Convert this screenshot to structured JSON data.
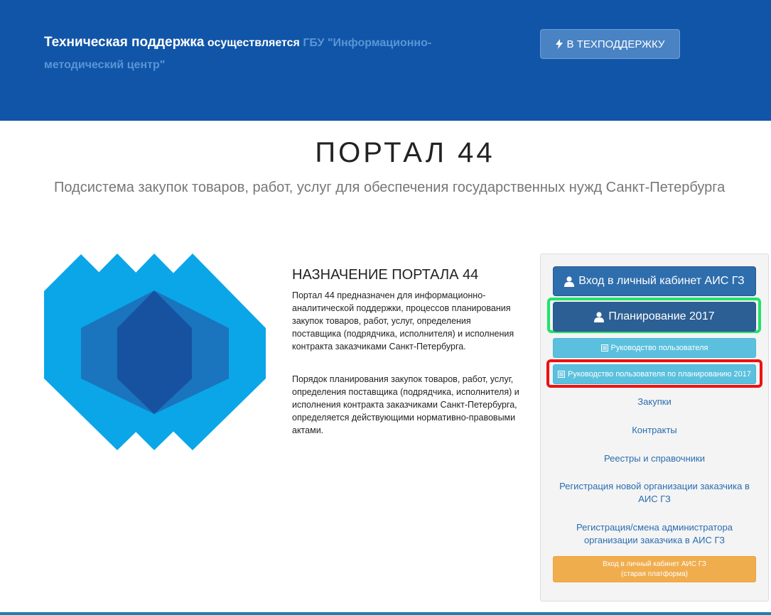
{
  "header": {
    "support_lead": "Техническая поддержка",
    "support_mid": " осуществляется ",
    "support_org": "ГБУ \"Информационно-методический центр\"",
    "support_button": "В ТЕХПОДДЕРЖКУ"
  },
  "hero": {
    "title": "ПОРТАЛ 44",
    "subtitle": "Подсистема закупок товаров, работ, услуг для обеспечения государственных нужд Санкт-Петербурга"
  },
  "about": {
    "heading": "НАЗНАЧЕНИЕ ПОРТАЛА 44",
    "paragraph1": "Портал 44 предназначен для информационно-аналитической поддержки, процессов планирования закупок товаров, работ, услуг, определения поставщика (подрядчика, исполнителя) и исполнения контракта заказчиками Санкт-Петербурга.",
    "paragraph2": "Порядок планирования закупок товаров, работ, услуг, определения поставщика (подрядчика, исполнителя) и исполнения контракта заказчиками Санкт-Петербурга, определяется действующими нормативно-правовыми актами."
  },
  "panel": {
    "login_button": "Вход в личный кабинет АИС ГЗ",
    "planning_button": "Планирование 2017",
    "guide_button": "Руководство пользователя",
    "planning_guide_button": "Руководство пользователя по планированию 2017",
    "links": {
      "purchases": "Закупки",
      "contracts": "Контракты",
      "registers": "Реестры и справочники",
      "register_org": "Регистрация новой организации заказчика в АИС ГЗ",
      "register_admin": "Регистрация/смена администратора организации заказчика в АИС ГЗ"
    },
    "old_login_line1": "Вход в личный кабинет АИС ГЗ",
    "old_login_line2": "(старая платформа)"
  },
  "icons": {
    "support": "bolt-icon",
    "user": "user-icon",
    "document": "document-icon"
  },
  "colors": {
    "header_bg": "#1155a8",
    "primary": "#2f6ead",
    "info": "#5bc0de",
    "warning": "#f0ad4e",
    "highlight_green": "#1fe36a",
    "highlight_red": "#ee1111",
    "logo_light": "#0aa6e8",
    "logo_mid": "#1a74be",
    "logo_dark": "#1652a0"
  }
}
